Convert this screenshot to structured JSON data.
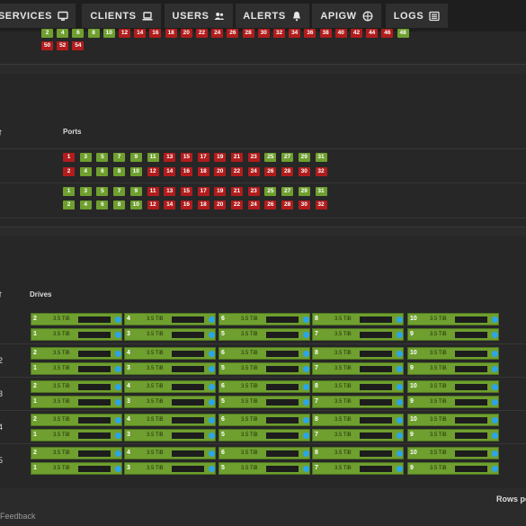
{
  "nav": {
    "tabs": [
      {
        "label": "SERVICES",
        "icon": "monitor-icon"
      },
      {
        "label": "CLIENTS",
        "icon": "laptop-icon"
      },
      {
        "label": "USERS",
        "icon": "users-icon"
      },
      {
        "label": "ALERTS",
        "icon": "bell-icon"
      },
      {
        "label": "APIGW",
        "icon": "globe-icon"
      },
      {
        "label": "LOGS",
        "icon": "list-icon"
      }
    ]
  },
  "top_panel": {
    "row_even": [
      "2",
      "4",
      "6",
      "8",
      "10",
      "12",
      "14",
      "16",
      "18",
      "20",
      "22",
      "24",
      "26",
      "28",
      "30",
      "32",
      "34",
      "36",
      "38",
      "40",
      "42",
      "44",
      "46",
      "48"
    ],
    "row_even_status": [
      "up",
      "up",
      "up",
      "up",
      "up",
      "down",
      "down",
      "down",
      "down",
      "down",
      "down",
      "down",
      "down",
      "down",
      "down",
      "down",
      "down",
      "down",
      "down",
      "down",
      "down",
      "down",
      "down",
      "up"
    ],
    "row_extra": [
      "50",
      "52",
      "54"
    ],
    "row_extra_status": [
      "down",
      "down",
      "down"
    ]
  },
  "ports_panel": {
    "sort_icon": "arrow-up-icon",
    "sort_glyph": "↑",
    "header": "Ports",
    "switches": [
      {
        "odd": [
          "1",
          "3",
          "5",
          "7",
          "9",
          "11",
          "13",
          "15",
          "17",
          "19",
          "21",
          "23",
          "25",
          "27",
          "29",
          "31"
        ],
        "odd_status": [
          "down",
          "up",
          "up",
          "up",
          "up",
          "up",
          "down",
          "down",
          "down",
          "down",
          "down",
          "down",
          "up",
          "up",
          "up",
          "up"
        ],
        "even": [
          "2",
          "4",
          "6",
          "8",
          "10",
          "12",
          "14",
          "16",
          "18",
          "20",
          "22",
          "24",
          "26",
          "28",
          "30",
          "32"
        ],
        "even_status": [
          "down",
          "up",
          "up",
          "up",
          "up",
          "down",
          "down",
          "down",
          "down",
          "down",
          "down",
          "down",
          "down",
          "down",
          "down",
          "down"
        ]
      },
      {
        "odd": [
          "1",
          "3",
          "5",
          "7",
          "9",
          "11",
          "13",
          "15",
          "17",
          "19",
          "21",
          "23",
          "25",
          "27",
          "29",
          "31"
        ],
        "odd_status": [
          "up",
          "up",
          "up",
          "up",
          "up",
          "down",
          "down",
          "down",
          "down",
          "down",
          "down",
          "down",
          "up",
          "up",
          "up",
          "up"
        ],
        "even": [
          "2",
          "4",
          "6",
          "8",
          "10",
          "12",
          "14",
          "16",
          "18",
          "20",
          "22",
          "24",
          "26",
          "28",
          "30",
          "32"
        ],
        "even_status": [
          "up",
          "up",
          "up",
          "up",
          "up",
          "down",
          "down",
          "down",
          "down",
          "down",
          "down",
          "down",
          "down",
          "down",
          "down",
          "down"
        ]
      }
    ]
  },
  "drives_panel": {
    "sort_icon": "arrow-up-icon",
    "sort_glyph": "↑",
    "header": "Drives",
    "capacity": "3.5 TiB",
    "row_labels": [
      "",
      "2",
      "3",
      "4",
      "5"
    ],
    "slot_top": [
      "2",
      "4",
      "6",
      "8",
      "10"
    ],
    "slot_bottom": [
      "1",
      "3",
      "5",
      "7",
      "9"
    ]
  },
  "footer": {
    "feedback": "Feedback",
    "rows_per_page": "Rows pe"
  }
}
